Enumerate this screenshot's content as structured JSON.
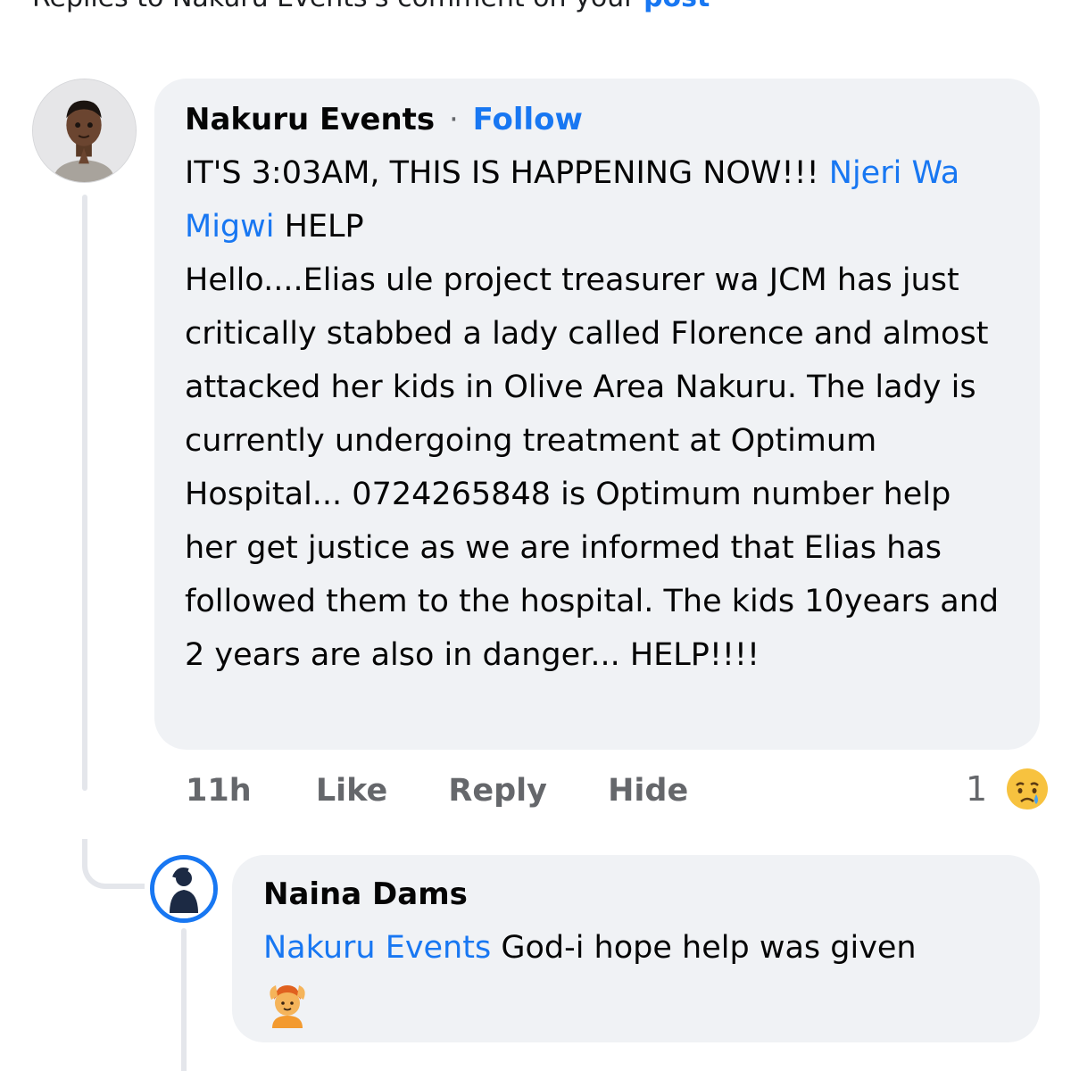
{
  "header": {
    "text": "Replies to Nakuru Events's comment on your",
    "link": "post"
  },
  "comment": {
    "author": "Nakuru Events",
    "separator": "·",
    "follow_label": "Follow",
    "text_1": "IT'S 3:03AM, THIS IS HAPPENING NOW!!! ",
    "mention": "Njeri Wa Migwi",
    "text_2": " HELP",
    "body": "Hello....Elias ule project treasurer wa JCM has just critically stabbed a lady called Florence and almost attacked her kids in Olive Area Nakuru. The lady is currently undergoing treatment at Optimum Hospital... 0724265848 is Optimum number help her get justice as we are informed that Elias has followed them to the hospital. The kids 10years and 2 years are also in danger... HELP!!!!",
    "time": "11h",
    "like_label": "Like",
    "reply_label": "Reply",
    "hide_label": "Hide",
    "reaction_count": "1",
    "reaction_icon": "crying-face-icon"
  },
  "reply": {
    "author": "Naina Dams",
    "mention": "Nakuru Events",
    "text": " God-i hope help was given",
    "emoji_icon": "person-gesturing-ok-icon"
  },
  "colors": {
    "accent": "#1877f2",
    "bubble": "#f0f2f5",
    "muted": "#65676b",
    "thread": "#e4e6eb"
  }
}
